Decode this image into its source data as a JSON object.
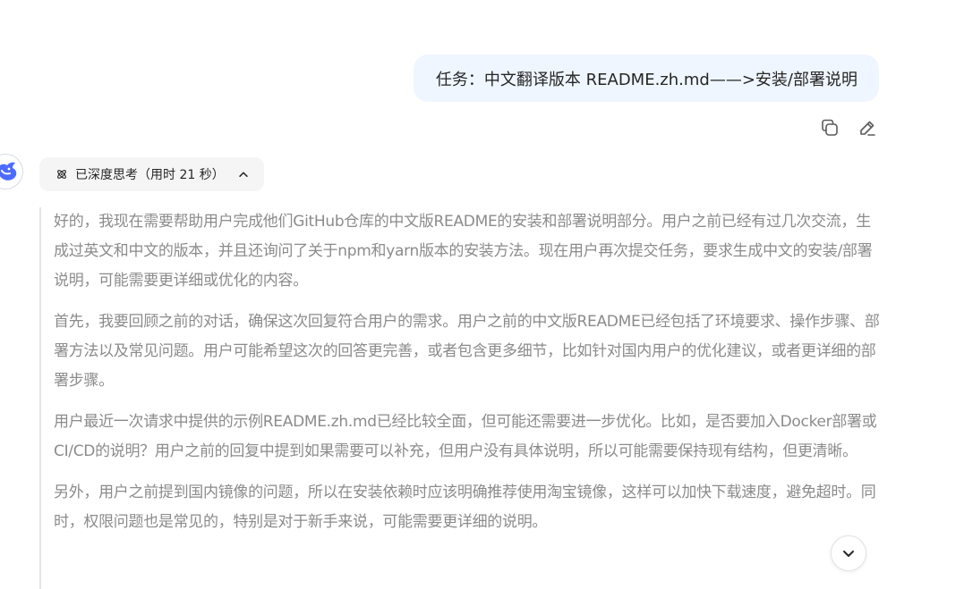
{
  "user_message": {
    "text": "任务：中文翻译版本 README.zh.md——>安装/部署说明"
  },
  "message_actions": {
    "copy_icon": "copy-icon",
    "edit_icon": "edit-icon"
  },
  "assistant": {
    "avatar_icon": "whale-logo-icon",
    "thinking": {
      "label": "已深度思考（用时 21 秒）",
      "icon": "atom-icon",
      "toggle_icon": "chevron-up-icon",
      "paragraphs": [
        "好的，我现在需要帮助用户完成他们GitHub仓库的中文版README的安装和部署说明部分。用户之前已经有过几次交流，生成过英文和中文的版本，并且还询问了关于npm和yarn版本的安装方法。现在用户再次提交任务，要求生成中文的安装/部署说明，可能需要更详细或优化的内容。",
        "首先，我要回顾之前的对话，确保这次回复符合用户的需求。用户之前的中文版README已经包括了环境要求、操作步骤、部署方法以及常见问题。用户可能希望这次的回答更完善，或者包含更多细节，比如针对国内用户的优化建议，或者更详细的部署步骤。",
        "用户最近一次请求中提供的示例README.zh.md已经比较全面，但可能还需要进一步优化。比如，是否要加入Docker部署或CI/CD的说明？用户之前的回复中提到如果需要可以补充，但用户没有具体说明，所以可能需要保持现有结构，但更清晰。",
        "另外，用户之前提到国内镜像的问题，所以在安装依赖时应该明确推荐使用淘宝镜像，这样可以加快下载速度，避免超时。同时，权限问题也是常见的，特别是对于新手来说，可能需要更详细的说明。"
      ]
    }
  },
  "scroll_button_icon": "chevron-down-icon"
}
